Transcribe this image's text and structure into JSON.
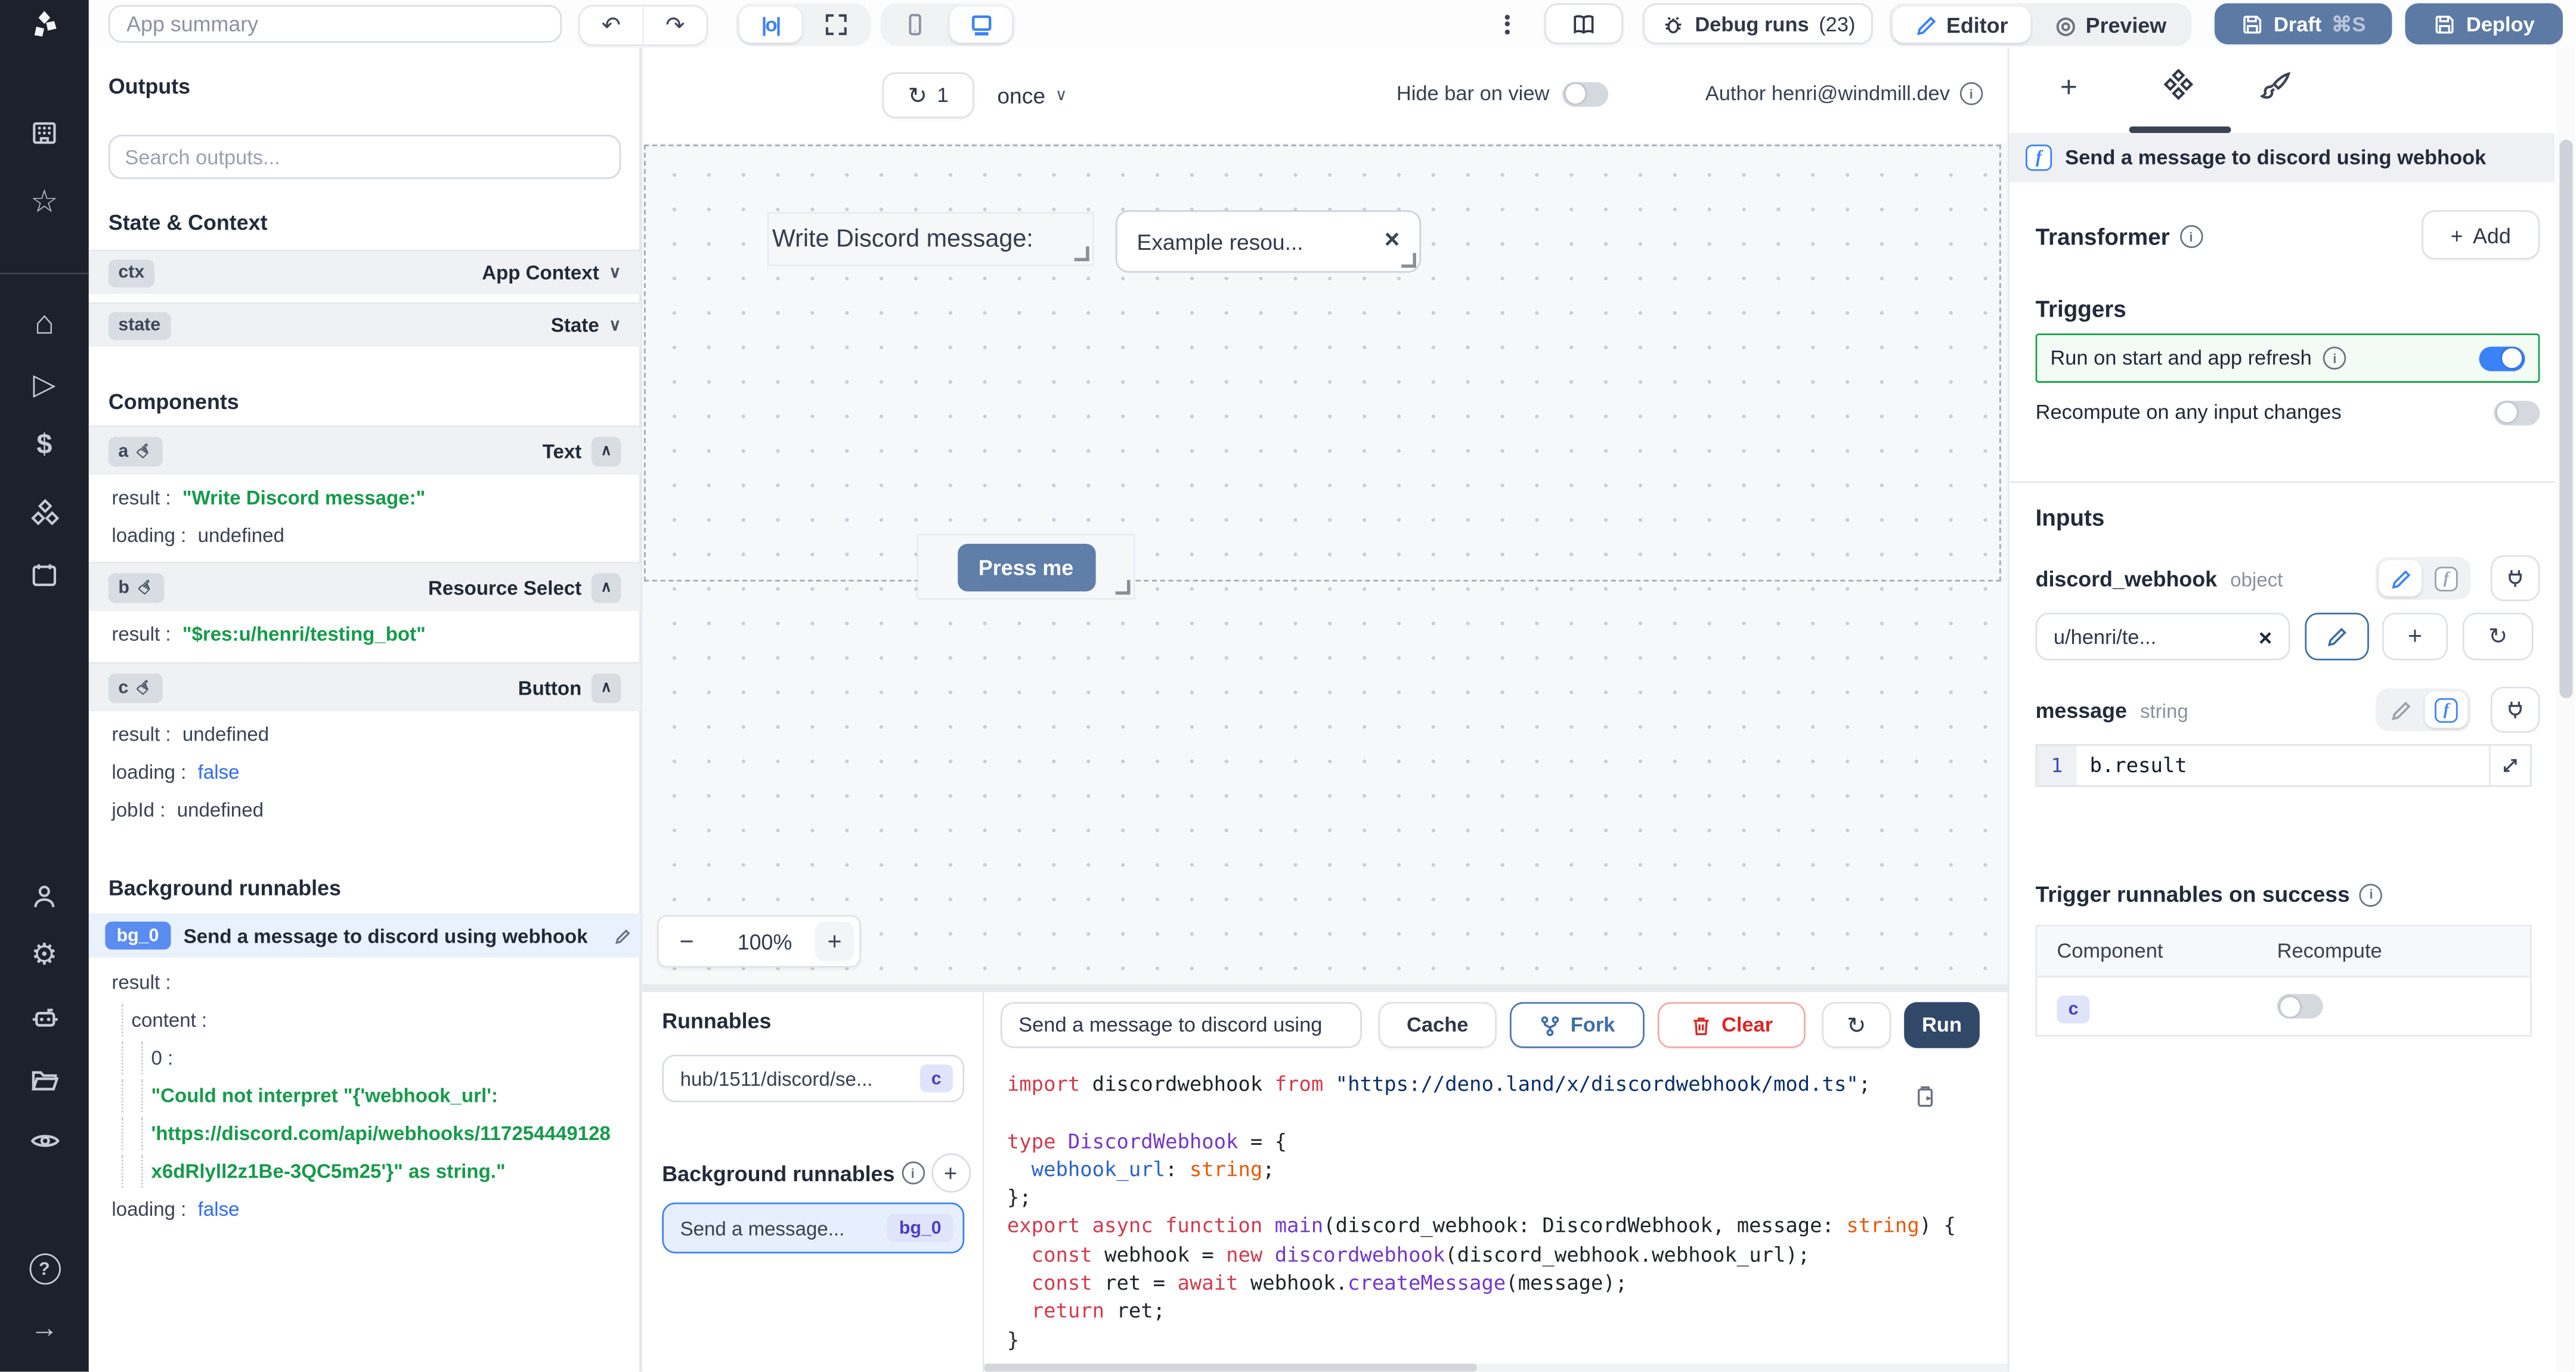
{
  "topbar": {
    "app_summary_placeholder": "App summary",
    "debug_runs_label": "Debug runs",
    "debug_runs_count": "(23)",
    "editor_label": "Editor",
    "preview_label": "Preview",
    "draft_label": "Draft",
    "draft_shortcut": "⌘S",
    "deploy_label": "Deploy"
  },
  "canvas_bar": {
    "refresh_count": "1",
    "mode": "once",
    "hide_bar_label": "Hide bar on view",
    "author_label": "Author henri@windmill.dev"
  },
  "canvas": {
    "text_component": "Write Discord message:",
    "select_value": "Example resou...",
    "button_label": "Press me",
    "zoom_level": "100%"
  },
  "outputs": {
    "title": "Outputs",
    "search_placeholder": "Search outputs...",
    "state_context_title": "State & Context",
    "state_items": [
      {
        "id": "ctx",
        "type": "App Context"
      },
      {
        "id": "state",
        "type": "State"
      }
    ],
    "components_title": "Components",
    "components": [
      {
        "id": "a",
        "type": "Text",
        "kv": [
          {
            "k": "result :",
            "v": "\"Write Discord message:\""
          },
          {
            "k": "loading :",
            "v": "undefined"
          }
        ]
      },
      {
        "id": "b",
        "type": "Resource Select",
        "kv": [
          {
            "k": "result :",
            "v": "\"$res:u/henri/testing_bot\""
          }
        ]
      },
      {
        "id": "c",
        "type": "Button",
        "kv": [
          {
            "k": "result :",
            "v": "undefined"
          },
          {
            "k": "loading :",
            "v": "false"
          },
          {
            "k": "jobId :",
            "v": "undefined"
          }
        ]
      }
    ],
    "background_title": "Background runnables",
    "background": {
      "id": "bg_0",
      "label": "Send a message to discord using webhook",
      "details": {
        "result_key": "result :",
        "content_key": "content :",
        "index_key": "0 :",
        "error_line1": "\"Could not interpret \"{'webhook_url':",
        "error_line2": "'https://discord.com/api/webhooks/117254449128",
        "error_line3": "x6dRlyll2z1Be-3QC5m25'}\" as string.\"",
        "loading_key": "loading :",
        "loading_value": "false"
      }
    }
  },
  "runnables": {
    "title": "Runnables",
    "item_label": "hub/1511/discord/se...",
    "item_badge": "c",
    "background_title": "Background runnables",
    "bg_item_label": "Send a message...",
    "bg_item_badge": "bg_0"
  },
  "editor": {
    "name_value": "Send a message to discord using",
    "cache_label": "Cache",
    "fork_label": "Fork",
    "clear_label": "Clear",
    "run_label": "Run",
    "code_lines": [
      [
        {
          "t": "import ",
          "c": "kw"
        },
        {
          "t": "discordwebhook ",
          "c": "pl"
        },
        {
          "t": "from ",
          "c": "kw"
        },
        {
          "t": "\"https://deno.land/x/discordwebhook/mod.ts\"",
          "c": "str"
        },
        {
          "t": ";",
          "c": "pl"
        }
      ],
      [],
      [
        {
          "t": "type ",
          "c": "kw"
        },
        {
          "t": "DiscordWebhook",
          "c": "ty"
        },
        {
          "t": " = {",
          "c": "pl"
        }
      ],
      [
        {
          "t": "  ",
          "c": "pl"
        },
        {
          "t": "webhook_url",
          "c": "pr"
        },
        {
          "t": ": ",
          "c": "pl"
        },
        {
          "t": "string",
          "c": "or"
        },
        {
          "t": ";",
          "c": "pl"
        }
      ],
      [
        {
          "t": "};",
          "c": "pl"
        }
      ],
      [
        {
          "t": "export async function ",
          "c": "kw"
        },
        {
          "t": "main",
          "c": "ty"
        },
        {
          "t": "(discord_webhook: DiscordWebhook, message: ",
          "c": "pl"
        },
        {
          "t": "string",
          "c": "or"
        },
        {
          "t": ") {",
          "c": "pl"
        }
      ],
      [
        {
          "t": "  ",
          "c": "pl"
        },
        {
          "t": "const ",
          "c": "kw"
        },
        {
          "t": "webhook = ",
          "c": "pl"
        },
        {
          "t": "new ",
          "c": "kw"
        },
        {
          "t": "discordwebhook",
          "c": "ty"
        },
        {
          "t": "(discord_webhook.webhook_url);",
          "c": "pl"
        }
      ],
      [
        {
          "t": "  ",
          "c": "pl"
        },
        {
          "t": "const ",
          "c": "kw"
        },
        {
          "t": "ret = ",
          "c": "pl"
        },
        {
          "t": "await ",
          "c": "kw"
        },
        {
          "t": "webhook.",
          "c": "pl"
        },
        {
          "t": "createMessage",
          "c": "ty"
        },
        {
          "t": "(message);",
          "c": "pl"
        }
      ],
      [
        {
          "t": "  ",
          "c": "pl"
        },
        {
          "t": "return ",
          "c": "kw"
        },
        {
          "t": "ret;",
          "c": "pl"
        }
      ],
      [
        {
          "t": "}",
          "c": "pl"
        }
      ]
    ]
  },
  "right_panel": {
    "header": "Send a message to discord using webhook",
    "transformer_label": "Transformer",
    "add_label": "Add",
    "triggers_title": "Triggers",
    "run_on_start_label": "Run on start and app refresh",
    "recompute_label": "Recompute on any input changes",
    "inputs_title": "Inputs",
    "discord_webhook": {
      "name": "discord_webhook",
      "type": "object",
      "value": "u/henri/te..."
    },
    "message": {
      "name": "message",
      "type": "string",
      "line_number": "1",
      "expression": "b.result"
    },
    "trigger_success_title": "Trigger runnables on success",
    "table": {
      "col_component": "Component",
      "col_recompute": "Recompute",
      "row_component": "c"
    }
  },
  "icons": {
    "undo": "↶",
    "redo": "↷",
    "align": "|o|",
    "preview": "◎",
    "chevron_down": "∨",
    "chevron_up": "∧",
    "close": "×",
    "minus": "−",
    "plus": "+",
    "refresh": "↻",
    "star": "☆",
    "home": "⌂",
    "play": "▷",
    "dollar": "$",
    "gear": "⚙",
    "arrow_right": "→",
    "hand": "☞",
    "info": "i"
  },
  "colors": {
    "accent": "#3b82f6",
    "slate_button": "#5d7aa4",
    "run_button": "#324868",
    "green_value": "#179a4b",
    "blue_value": "#2f6bf0",
    "green_border": "#17a34a",
    "badge_indigo_bg": "#e0e4fb",
    "badge_indigo_text": "#4c3fc0",
    "bg0_badge": "#5b8cf0"
  }
}
